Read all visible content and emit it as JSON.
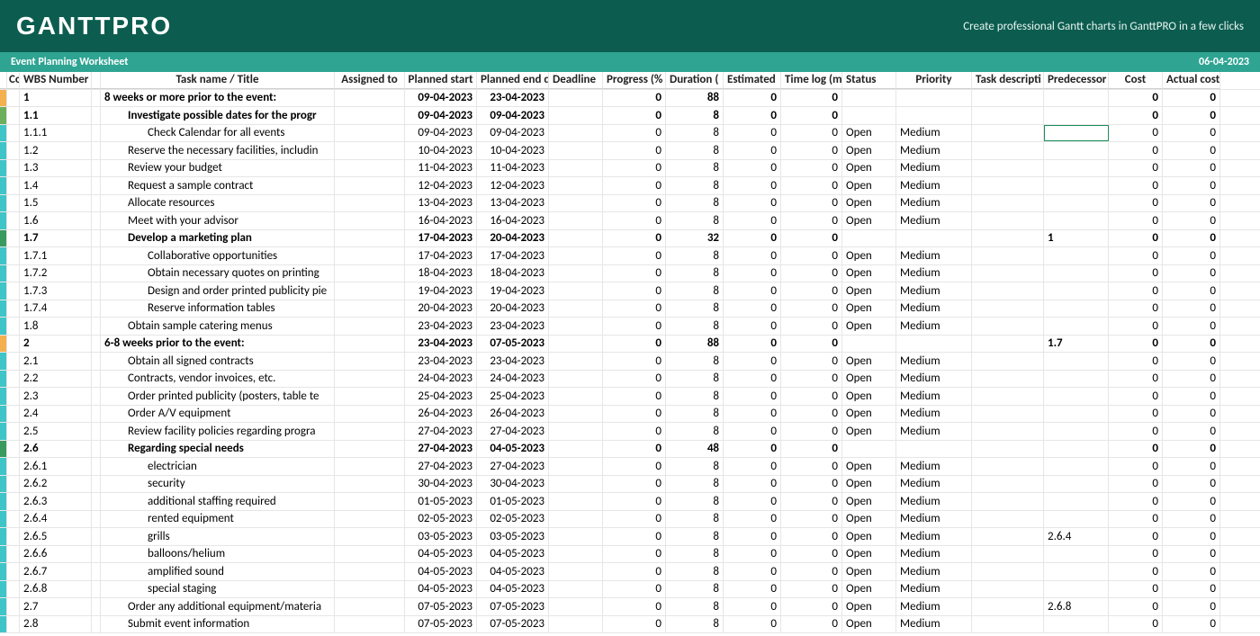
{
  "header": {
    "logo": "GANTTPRO",
    "tagline": "Create professional Gantt charts in GanttPRO in a few clicks"
  },
  "subheader": {
    "title": "Event Planning Worksheet",
    "date": "06-04-2023"
  },
  "columns": {
    "co": "Co",
    "wbs": "WBS Number",
    "title": "Task name / Title",
    "assigned": "Assigned to",
    "pstart": "Planned start",
    "pend": "Planned end d",
    "deadline": "Deadline",
    "progress": "Progress (%",
    "duration": "Duration (",
    "estimated": "Estimated",
    "timelog": "Time log (m",
    "status": "Status",
    "priority": "Priority",
    "tdesc": "Task descripti",
    "pred": "Predecessor",
    "cost": "Cost",
    "acost": "Actual cost"
  },
  "rows": [
    {
      "color": "clr-orange",
      "wbs": "1",
      "title": "8 weeks or more prior to the event:",
      "indent": 0,
      "bold": true,
      "pstart": "09-04-2023",
      "pend": "23-04-2023",
      "progress": "0",
      "duration": "88",
      "estimated": "0",
      "timelog": "0",
      "status": "",
      "priority": "",
      "pred": "",
      "cost": "0",
      "acost": "0"
    },
    {
      "color": "clr-green",
      "wbs": "1.1",
      "title": "Investigate possible dates for the progr",
      "indent": 1,
      "bold": true,
      "pstart": "09-04-2023",
      "pend": "09-04-2023",
      "progress": "0",
      "duration": "8",
      "estimated": "0",
      "timelog": "0",
      "status": "",
      "priority": "",
      "pred": "",
      "cost": "0",
      "acost": "0"
    },
    {
      "color": "clr-teal",
      "wbs": "1.1.1",
      "title": "Check Calendar for all events",
      "indent": 2,
      "bold": false,
      "pstart": "09-04-2023",
      "pend": "09-04-2023",
      "progress": "0",
      "duration": "8",
      "estimated": "0",
      "timelog": "0",
      "status": "Open",
      "priority": "Medium",
      "pred": "",
      "cost": "0",
      "acost": "0",
      "selPred": true
    },
    {
      "color": "clr-teal",
      "wbs": "1.2",
      "title": "Reserve the necessary facilities, includin",
      "indent": 1,
      "bold": false,
      "pstart": "10-04-2023",
      "pend": "10-04-2023",
      "progress": "0",
      "duration": "8",
      "estimated": "0",
      "timelog": "0",
      "status": "Open",
      "priority": "Medium",
      "pred": "",
      "cost": "0",
      "acost": "0"
    },
    {
      "color": "clr-teal",
      "wbs": "1.3",
      "title": "Review your budget",
      "indent": 1,
      "bold": false,
      "pstart": "11-04-2023",
      "pend": "11-04-2023",
      "progress": "0",
      "duration": "8",
      "estimated": "0",
      "timelog": "0",
      "status": "Open",
      "priority": "Medium",
      "pred": "",
      "cost": "0",
      "acost": "0"
    },
    {
      "color": "clr-teal",
      "wbs": "1.4",
      "title": "Request a sample contract",
      "indent": 1,
      "bold": false,
      "pstart": "12-04-2023",
      "pend": "12-04-2023",
      "progress": "0",
      "duration": "8",
      "estimated": "0",
      "timelog": "0",
      "status": "Open",
      "priority": "Medium",
      "pred": "",
      "cost": "0",
      "acost": "0"
    },
    {
      "color": "clr-teal",
      "wbs": "1.5",
      "title": "Allocate resources",
      "indent": 1,
      "bold": false,
      "pstart": "13-04-2023",
      "pend": "13-04-2023",
      "progress": "0",
      "duration": "8",
      "estimated": "0",
      "timelog": "0",
      "status": "Open",
      "priority": "Medium",
      "pred": "",
      "cost": "0",
      "acost": "0"
    },
    {
      "color": "clr-teal",
      "wbs": "1.6",
      "title": "Meet with your advisor",
      "indent": 1,
      "bold": false,
      "pstart": "16-04-2023",
      "pend": "16-04-2023",
      "progress": "0",
      "duration": "8",
      "estimated": "0",
      "timelog": "0",
      "status": "Open",
      "priority": "Medium",
      "pred": "",
      "cost": "0",
      "acost": "0"
    },
    {
      "color": "clr-dgreen",
      "wbs": "1.7",
      "title": "Develop a marketing plan",
      "indent": 1,
      "bold": true,
      "pstart": "17-04-2023",
      "pend": "20-04-2023",
      "progress": "0",
      "duration": "32",
      "estimated": "0",
      "timelog": "0",
      "status": "",
      "priority": "",
      "pred": "1",
      "cost": "0",
      "acost": "0"
    },
    {
      "color": "clr-teal",
      "wbs": "1.7.1",
      "title": "Collaborative opportunities",
      "indent": 2,
      "bold": false,
      "pstart": "17-04-2023",
      "pend": "17-04-2023",
      "progress": "0",
      "duration": "8",
      "estimated": "0",
      "timelog": "0",
      "status": "Open",
      "priority": "Medium",
      "pred": "",
      "cost": "0",
      "acost": "0"
    },
    {
      "color": "clr-teal",
      "wbs": "1.7.2",
      "title": "Obtain necessary quotes on printing",
      "indent": 2,
      "bold": false,
      "pstart": "18-04-2023",
      "pend": "18-04-2023",
      "progress": "0",
      "duration": "8",
      "estimated": "0",
      "timelog": "0",
      "status": "Open",
      "priority": "Medium",
      "pred": "",
      "cost": "0",
      "acost": "0"
    },
    {
      "color": "clr-teal",
      "wbs": "1.7.3",
      "title": "Design and order printed publicity pie",
      "indent": 2,
      "bold": false,
      "pstart": "19-04-2023",
      "pend": "19-04-2023",
      "progress": "0",
      "duration": "8",
      "estimated": "0",
      "timelog": "0",
      "status": "Open",
      "priority": "Medium",
      "pred": "",
      "cost": "0",
      "acost": "0"
    },
    {
      "color": "clr-teal",
      "wbs": "1.7.4",
      "title": "Reserve information tables",
      "indent": 2,
      "bold": false,
      "pstart": "20-04-2023",
      "pend": "20-04-2023",
      "progress": "0",
      "duration": "8",
      "estimated": "0",
      "timelog": "0",
      "status": "Open",
      "priority": "Medium",
      "pred": "",
      "cost": "0",
      "acost": "0"
    },
    {
      "color": "clr-teal",
      "wbs": "1.8",
      "title": "Obtain sample catering menus",
      "indent": 1,
      "bold": false,
      "pstart": "23-04-2023",
      "pend": "23-04-2023",
      "progress": "0",
      "duration": "8",
      "estimated": "0",
      "timelog": "0",
      "status": "Open",
      "priority": "Medium",
      "pred": "",
      "cost": "0",
      "acost": "0"
    },
    {
      "color": "clr-orange",
      "wbs": "2",
      "title": "6-8 weeks prior to the event:",
      "indent": 0,
      "bold": true,
      "pstart": "23-04-2023",
      "pend": "07-05-2023",
      "progress": "0",
      "duration": "88",
      "estimated": "0",
      "timelog": "0",
      "status": "",
      "priority": "",
      "pred": "1.7",
      "cost": "0",
      "acost": "0"
    },
    {
      "color": "clr-teal",
      "wbs": "2.1",
      "title": "Obtain all signed contracts",
      "indent": 1,
      "bold": false,
      "pstart": "23-04-2023",
      "pend": "23-04-2023",
      "progress": "0",
      "duration": "8",
      "estimated": "0",
      "timelog": "0",
      "status": "Open",
      "priority": "Medium",
      "pred": "",
      "cost": "0",
      "acost": "0"
    },
    {
      "color": "clr-teal",
      "wbs": "2.2",
      "title": "Contracts, vendor invoices, etc.",
      "indent": 1,
      "bold": false,
      "pstart": "24-04-2023",
      "pend": "24-04-2023",
      "progress": "0",
      "duration": "8",
      "estimated": "0",
      "timelog": "0",
      "status": "Open",
      "priority": "Medium",
      "pred": "",
      "cost": "0",
      "acost": "0"
    },
    {
      "color": "clr-teal",
      "wbs": "2.3",
      "title": "Order printed publicity (posters, table te",
      "indent": 1,
      "bold": false,
      "pstart": "25-04-2023",
      "pend": "25-04-2023",
      "progress": "0",
      "duration": "8",
      "estimated": "0",
      "timelog": "0",
      "status": "Open",
      "priority": "Medium",
      "pred": "",
      "cost": "0",
      "acost": "0"
    },
    {
      "color": "clr-teal",
      "wbs": "2.4",
      "title": "Order A/V equipment",
      "indent": 1,
      "bold": false,
      "pstart": "26-04-2023",
      "pend": "26-04-2023",
      "progress": "0",
      "duration": "8",
      "estimated": "0",
      "timelog": "0",
      "status": "Open",
      "priority": "Medium",
      "pred": "",
      "cost": "0",
      "acost": "0"
    },
    {
      "color": "clr-teal",
      "wbs": "2.5",
      "title": "Review facility policies regarding progra",
      "indent": 1,
      "bold": false,
      "pstart": "27-04-2023",
      "pend": "27-04-2023",
      "progress": "0",
      "duration": "8",
      "estimated": "0",
      "timelog": "0",
      "status": "Open",
      "priority": "Medium",
      "pred": "",
      "cost": "0",
      "acost": "0"
    },
    {
      "color": "clr-dgreen",
      "wbs": "2.6",
      "title": "Regarding special needs",
      "indent": 1,
      "bold": true,
      "pstart": "27-04-2023",
      "pend": "04-05-2023",
      "progress": "0",
      "duration": "48",
      "estimated": "0",
      "timelog": "0",
      "status": "",
      "priority": "",
      "pred": "",
      "cost": "0",
      "acost": "0"
    },
    {
      "color": "clr-teal",
      "wbs": "2.6.1",
      "title": "electrician",
      "indent": 2,
      "bold": false,
      "pstart": "27-04-2023",
      "pend": "27-04-2023",
      "progress": "0",
      "duration": "8",
      "estimated": "0",
      "timelog": "0",
      "status": "Open",
      "priority": "Medium",
      "pred": "",
      "cost": "0",
      "acost": "0"
    },
    {
      "color": "clr-teal",
      "wbs": "2.6.2",
      "title": "security",
      "indent": 2,
      "bold": false,
      "pstart": "30-04-2023",
      "pend": "30-04-2023",
      "progress": "0",
      "duration": "8",
      "estimated": "0",
      "timelog": "0",
      "status": "Open",
      "priority": "Medium",
      "pred": "",
      "cost": "0",
      "acost": "0"
    },
    {
      "color": "clr-teal",
      "wbs": "2.6.3",
      "title": "additional staffing required",
      "indent": 2,
      "bold": false,
      "pstart": "01-05-2023",
      "pend": "01-05-2023",
      "progress": "0",
      "duration": "8",
      "estimated": "0",
      "timelog": "0",
      "status": "Open",
      "priority": "Medium",
      "pred": "",
      "cost": "0",
      "acost": "0"
    },
    {
      "color": "clr-teal",
      "wbs": "2.6.4",
      "title": "rented equipment",
      "indent": 2,
      "bold": false,
      "pstart": "02-05-2023",
      "pend": "02-05-2023",
      "progress": "0",
      "duration": "8",
      "estimated": "0",
      "timelog": "0",
      "status": "Open",
      "priority": "Medium",
      "pred": "",
      "cost": "0",
      "acost": "0"
    },
    {
      "color": "clr-teal",
      "wbs": "2.6.5",
      "title": "grills",
      "indent": 2,
      "bold": false,
      "pstart": "03-05-2023",
      "pend": "03-05-2023",
      "progress": "0",
      "duration": "8",
      "estimated": "0",
      "timelog": "0",
      "status": "Open",
      "priority": "Medium",
      "pred": "2.6.4",
      "cost": "0",
      "acost": "0"
    },
    {
      "color": "clr-teal",
      "wbs": "2.6.6",
      "title": "balloons/helium",
      "indent": 2,
      "bold": false,
      "pstart": "04-05-2023",
      "pend": "04-05-2023",
      "progress": "0",
      "duration": "8",
      "estimated": "0",
      "timelog": "0",
      "status": "Open",
      "priority": "Medium",
      "pred": "",
      "cost": "0",
      "acost": "0"
    },
    {
      "color": "clr-teal",
      "wbs": "2.6.7",
      "title": "amplified sound",
      "indent": 2,
      "bold": false,
      "pstart": "04-05-2023",
      "pend": "04-05-2023",
      "progress": "0",
      "duration": "8",
      "estimated": "0",
      "timelog": "0",
      "status": "Open",
      "priority": "Medium",
      "pred": "",
      "cost": "0",
      "acost": "0"
    },
    {
      "color": "clr-teal",
      "wbs": "2.6.8",
      "title": "special staging",
      "indent": 2,
      "bold": false,
      "pstart": "04-05-2023",
      "pend": "04-05-2023",
      "progress": "0",
      "duration": "8",
      "estimated": "0",
      "timelog": "0",
      "status": "Open",
      "priority": "Medium",
      "pred": "",
      "cost": "0",
      "acost": "0"
    },
    {
      "color": "clr-teal",
      "wbs": "2.7",
      "title": "Order any additional equipment/materia",
      "indent": 1,
      "bold": false,
      "pstart": "07-05-2023",
      "pend": "07-05-2023",
      "progress": "0",
      "duration": "8",
      "estimated": "0",
      "timelog": "0",
      "status": "Open",
      "priority": "Medium",
      "pred": "2.6.8",
      "cost": "0",
      "acost": "0"
    },
    {
      "color": "clr-teal",
      "wbs": "2.8",
      "title": "Submit event information",
      "indent": 1,
      "bold": false,
      "pstart": "07-05-2023",
      "pend": "07-05-2023",
      "progress": "0",
      "duration": "8",
      "estimated": "0",
      "timelog": "0",
      "status": "Open",
      "priority": "Medium",
      "pred": "",
      "cost": "0",
      "acost": "0"
    }
  ]
}
